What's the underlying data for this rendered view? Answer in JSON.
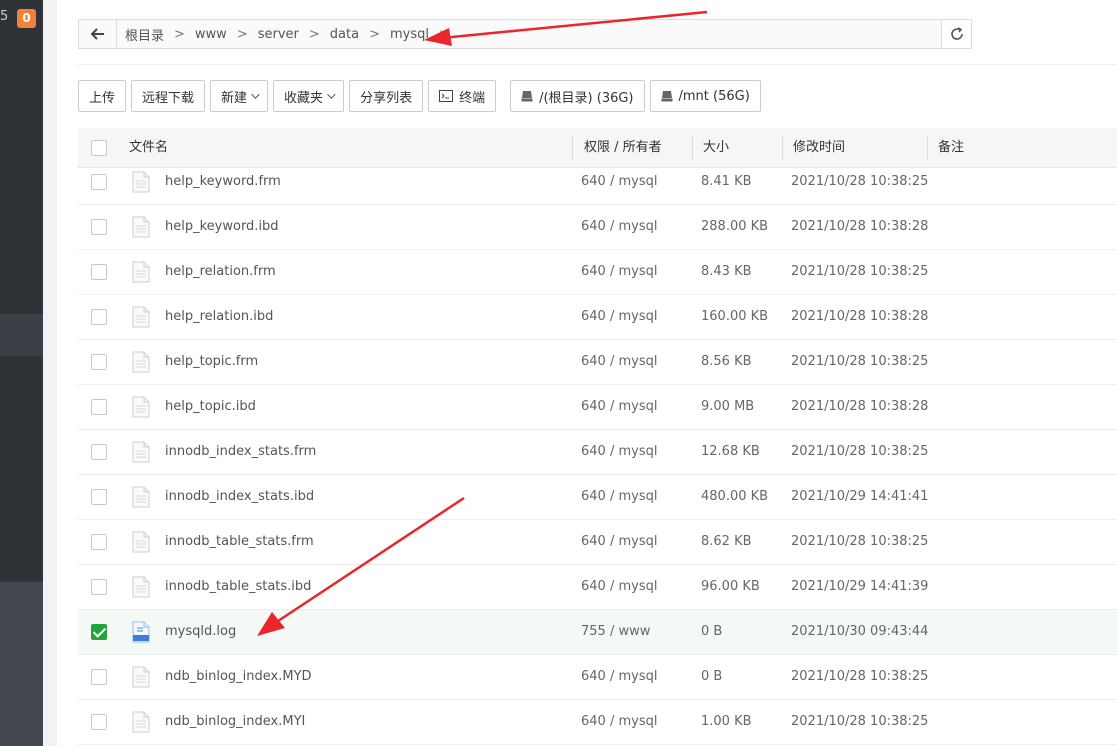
{
  "sidebar": {
    "partial_text": "5",
    "badge": "0"
  },
  "path": {
    "crumbs": [
      "根目录",
      "www",
      "server",
      "data",
      "mysql"
    ],
    "separator": ">"
  },
  "toolbar": {
    "upload": "上传",
    "remote_download": "远程下载",
    "new": "新建",
    "favorites": "收藏夹",
    "share_list": "分享列表",
    "terminal": "终端",
    "disk_root": "/(根目录) (36G)",
    "disk_mnt": "/mnt (56G)"
  },
  "table": {
    "headers": {
      "name": "文件名",
      "perm": "权限 / 所有者",
      "size": "大小",
      "mtime": "修改时间",
      "note": "备注"
    },
    "rows": [
      {
        "name": "help_keyword.frm",
        "perm": "640 / mysql",
        "size": "8.41 KB",
        "mtime": "2021/10/28 10:38:25",
        "checked": false,
        "icon": "file-icon"
      },
      {
        "name": "help_keyword.ibd",
        "perm": "640 / mysql",
        "size": "288.00 KB",
        "mtime": "2021/10/28 10:38:28",
        "checked": false,
        "icon": "file-icon"
      },
      {
        "name": "help_relation.frm",
        "perm": "640 / mysql",
        "size": "8.43 KB",
        "mtime": "2021/10/28 10:38:25",
        "checked": false,
        "icon": "file-icon"
      },
      {
        "name": "help_relation.ibd",
        "perm": "640 / mysql",
        "size": "160.00 KB",
        "mtime": "2021/10/28 10:38:28",
        "checked": false,
        "icon": "file-icon"
      },
      {
        "name": "help_topic.frm",
        "perm": "640 / mysql",
        "size": "8.56 KB",
        "mtime": "2021/10/28 10:38:25",
        "checked": false,
        "icon": "file-icon"
      },
      {
        "name": "help_topic.ibd",
        "perm": "640 / mysql",
        "size": "9.00 MB",
        "mtime": "2021/10/28 10:38:28",
        "checked": false,
        "icon": "file-icon"
      },
      {
        "name": "innodb_index_stats.frm",
        "perm": "640 / mysql",
        "size": "12.68 KB",
        "mtime": "2021/10/28 10:38:25",
        "checked": false,
        "icon": "file-icon"
      },
      {
        "name": "innodb_index_stats.ibd",
        "perm": "640 / mysql",
        "size": "480.00 KB",
        "mtime": "2021/10/29 14:41:41",
        "checked": false,
        "icon": "file-icon"
      },
      {
        "name": "innodb_table_stats.frm",
        "perm": "640 / mysql",
        "size": "8.62 KB",
        "mtime": "2021/10/28 10:38:25",
        "checked": false,
        "icon": "file-icon"
      },
      {
        "name": "innodb_table_stats.ibd",
        "perm": "640 / mysql",
        "size": "96.00 KB",
        "mtime": "2021/10/29 14:41:39",
        "checked": false,
        "icon": "file-icon"
      },
      {
        "name": "mysqld.log",
        "perm": "755 / www",
        "size": "0 B",
        "mtime": "2021/10/30 09:43:44",
        "checked": true,
        "icon": "log-file-icon"
      },
      {
        "name": "ndb_binlog_index.MYD",
        "perm": "640 / mysql",
        "size": "0 B",
        "mtime": "2021/10/28 10:38:25",
        "checked": false,
        "icon": "file-icon"
      },
      {
        "name": "ndb_binlog_index.MYI",
        "perm": "640 / mysql",
        "size": "1.00 KB",
        "mtime": "2021/10/28 10:38:25",
        "checked": false,
        "icon": "file-icon"
      }
    ]
  },
  "colors": {
    "accent_green": "#20a53a",
    "annotation_red": "#e8262b",
    "badge_orange": "#f0813a"
  }
}
